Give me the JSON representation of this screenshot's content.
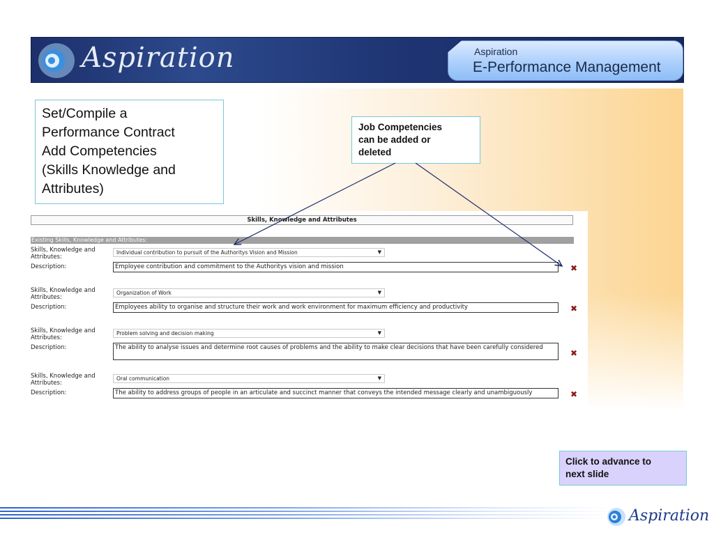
{
  "header": {
    "logo_text": "Aspiration",
    "pill_small": "Aspiration",
    "pill_big": "E-Performance Management"
  },
  "callouts": {
    "main": [
      "Set/Compile a",
      "Performance Contract",
      "Add Competencies",
      "(Skills Knowledge and",
      "Attributes)"
    ],
    "job": [
      "Job Competencies",
      "can be added or",
      "deleted"
    ],
    "next": [
      "Click to advance to",
      "next slide"
    ]
  },
  "form": {
    "title": "Skills, Knowledge and Attributes",
    "section": "Existing Skills, Knowledge and Attributes:",
    "label_ska": "Skills, Knowledge and Attributes:",
    "label_desc": "Description:",
    "delete_icon": "x-delete-icon",
    "entries": [
      {
        "selected": "Individual contribution to pursuit of the Authoritys Vision and Mission",
        "description": "Employee contribution and commitment to the Authoritys vision and mission"
      },
      {
        "selected": "Organization of Work",
        "description": "Employees ability to organise and structure their work and work environment for maximum efficiency and productivity"
      },
      {
        "selected": "Problem solving and decision making",
        "description": "The ability to analyse issues and determine root causes of problems and the ability to make clear decisions that have been carefully considered"
      },
      {
        "selected": "Oral communication",
        "description": "The ability to address groups of people in an articulate and succinct manner that conveys the intended message clearly and unambiguously"
      }
    ]
  },
  "footer": {
    "logo_text": "Aspiration"
  },
  "colors": {
    "banner": "#1f3574",
    "delete": "#8b1a1a",
    "arrow": "#1b2a6b",
    "next_box": "#d9d2fc"
  }
}
